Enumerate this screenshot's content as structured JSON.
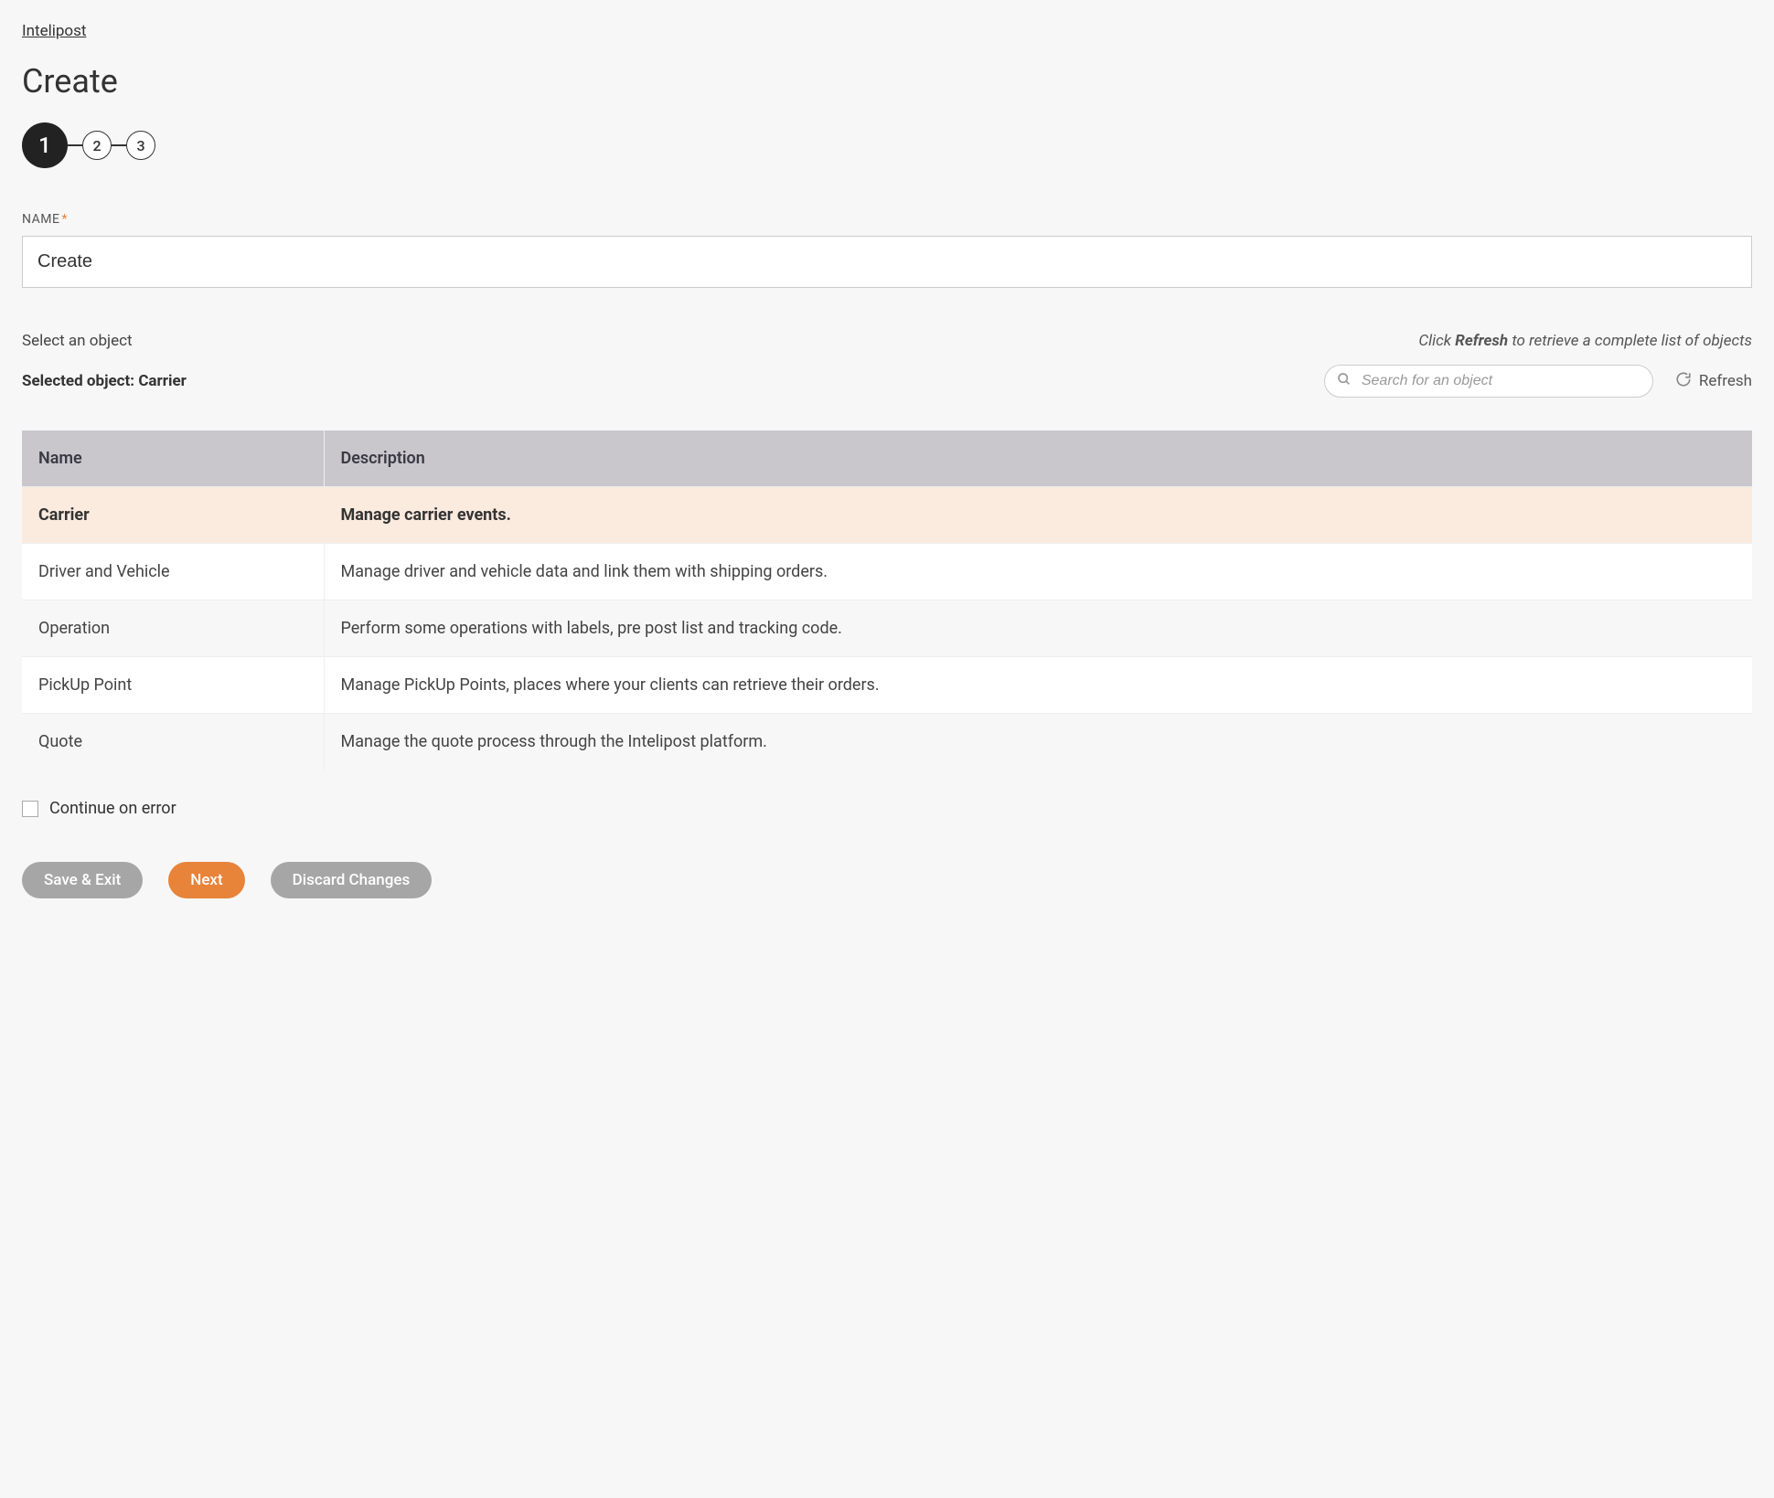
{
  "breadcrumb": "Intelipost",
  "page_title": "Create",
  "steps": [
    "1",
    "2",
    "3"
  ],
  "name_field": {
    "label": "NAME",
    "required_mark": "*",
    "value": "Create"
  },
  "object_section": {
    "select_label": "Select an object",
    "refresh_hint_prefix": "Click ",
    "refresh_hint_bold": "Refresh",
    "refresh_hint_suffix": " to retrieve a complete list of objects",
    "selected_label_prefix": "Selected object: ",
    "selected_value": "Carrier",
    "search_placeholder": "Search for an object",
    "refresh_button": "Refresh"
  },
  "table": {
    "headers": {
      "name": "Name",
      "description": "Description"
    },
    "rows": [
      {
        "name": "Carrier",
        "description": "Manage carrier events.",
        "selected": true
      },
      {
        "name": "Driver and Vehicle",
        "description": "Manage driver and vehicle data and link them with shipping orders.",
        "selected": false
      },
      {
        "name": "Operation",
        "description": "Perform some operations with labels, pre post list and tracking code.",
        "selected": false
      },
      {
        "name": "PickUp Point",
        "description": "Manage PickUp Points, places where your clients can retrieve their orders.",
        "selected": false
      },
      {
        "name": "Quote",
        "description": "Manage the quote process through the Intelipost platform.",
        "selected": false
      }
    ]
  },
  "continue_on_error_label": "Continue on error",
  "buttons": {
    "save_exit": "Save & Exit",
    "next": "Next",
    "discard": "Discard Changes"
  }
}
